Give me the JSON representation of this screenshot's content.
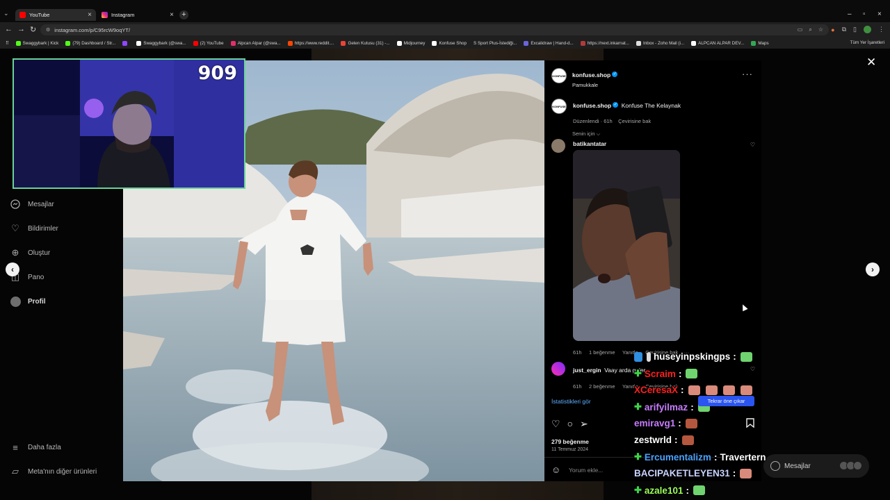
{
  "browser": {
    "tabs": [
      {
        "title": "YouTube",
        "color": "#ff0000",
        "active": true
      },
      {
        "title": "Instagram",
        "color": "#e1306c",
        "active": false
      }
    ],
    "url": "instagram.com/p/C95rcW9oqYT/",
    "bookmarks": [
      {
        "label": "Swaggybark | Kick",
        "color": "#53fc18"
      },
      {
        "label": "(79) Dashboard / Str...",
        "color": "#53fc18"
      },
      {
        "label": "",
        "color": "#9146ff"
      },
      {
        "label": "Swaggybark (@swa...",
        "color": "#ffffff"
      },
      {
        "label": "(2) YouTube",
        "color": "#ff0000"
      },
      {
        "label": "Alpcan Alpar (@swa...",
        "color": "#e1306c"
      },
      {
        "label": "https://www.reddit....",
        "color": "#ff4500"
      },
      {
        "label": "Gelen Kutusu (31) -...",
        "color": "#ea4335"
      },
      {
        "label": "Midjourney",
        "color": "#ffffff"
      },
      {
        "label": "Konfuse Shop",
        "color": "#ffffff"
      },
      {
        "label": "S Sport Plus-İstediği...",
        "color": "#1e6bff"
      },
      {
        "label": "Excalidraw | Hand-d...",
        "color": "#6965db"
      },
      {
        "label": "https://next.inkarnat...",
        "color": "#b23a3a"
      },
      {
        "label": "Inbox - Zoho Mail (i...",
        "color": "#dddddd"
      },
      {
        "label": "ALPCAN ALPAR DEV...",
        "color": "#ffffff"
      },
      {
        "label": "Maps",
        "color": "#34a853"
      }
    ],
    "bookmarks_right": "Tüm Yer İşaretleri"
  },
  "sidenav": {
    "items": [
      {
        "label": "Mesajlar",
        "icon": "messenger-icon",
        "bold": false
      },
      {
        "label": "Bildirimler",
        "icon": "heart-icon",
        "bold": false
      },
      {
        "label": "Oluştur",
        "icon": "plus-icon",
        "bold": false
      },
      {
        "label": "Pano",
        "icon": "dashboard-icon",
        "bold": false
      },
      {
        "label": "Profil",
        "icon": "profile-avatar",
        "bold": true
      }
    ],
    "bottom": [
      {
        "label": "Daha fazla",
        "icon": "menu-icon"
      },
      {
        "label": "Meta'nın diğer ürünleri",
        "icon": "meta-icon"
      }
    ]
  },
  "webcam": {
    "counter": "909"
  },
  "post": {
    "author": "konfuse.shop",
    "location": "Pamukkale",
    "avatar_text": "KONFUSE",
    "caption_user": "konfuse.shop",
    "caption": "Konfuse The Kelaynak",
    "caption_meta": "Düzenlendi · 61h",
    "translate": "Çevirisine bak",
    "sort_label": "Senin için",
    "comments": [
      {
        "user": "batikantatar",
        "text": "",
        "time": "61h",
        "likes": "1 beğenme",
        "reply": "Yanıtla",
        "translate": "Çevirisine bak"
      },
      {
        "user": "just_ergin",
        "text": "Vaay arda guler",
        "time": "61h",
        "likes": "2 beğenme",
        "reply": "Yanıtla",
        "translate": "Çevirisine bak"
      }
    ],
    "insights": "İstatistikleri gör",
    "like_count": "279 beğenme",
    "date": "11 Temmuz 2024",
    "comment_placeholder": "Yorum ekle..."
  },
  "chat": [
    {
      "user": "huseyinpskingps",
      "color": "#ffffff",
      "badge": "",
      "suffix": ":",
      "text": ""
    },
    {
      "user": "Scraim",
      "color": "#ff2020",
      "badge": "✚",
      "suffix": ":",
      "text": ""
    },
    {
      "user": "XCeresaX",
      "color": "#ff2020",
      "badge": "",
      "suffix": ":",
      "text": ""
    },
    {
      "user": "arifyilmaz",
      "color": "#c77dff",
      "badge": "✚",
      "suffix": ":",
      "text": ""
    },
    {
      "user": "emiravg1",
      "color": "#c77dff",
      "badge": "",
      "suffix": ":",
      "text": ""
    },
    {
      "user": "zestwrld",
      "color": "#ffffff",
      "badge": "",
      "suffix": ":",
      "text": ""
    },
    {
      "user": "Ercumentalizm",
      "color": "#4aa3ff",
      "badge": "✚",
      "suffix": ":",
      "text": "Travertern"
    },
    {
      "user": "BACIPAKETLEYEN31",
      "color": "#c9d4ff",
      "badge": "",
      "suffix": ":",
      "text": ""
    },
    {
      "user": "azale101",
      "color": "#9dff5a",
      "badge": "✚",
      "suffix": ":",
      "text": ""
    }
  ],
  "tooltip": "Tekrar öne çıkar",
  "messages_pill": "Mesajlar"
}
